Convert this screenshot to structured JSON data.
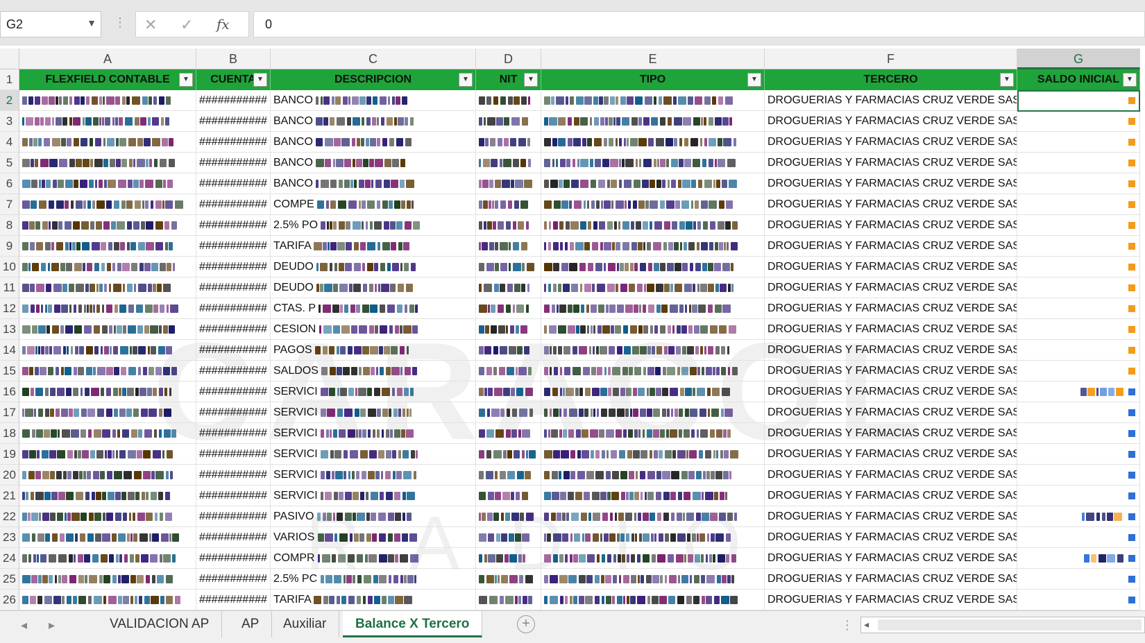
{
  "formula_bar": {
    "name_box": "G2",
    "cancel_glyph": "✕",
    "enter_glyph": "✓",
    "fx_glyph": "fx",
    "formula": "0"
  },
  "columns": [
    {
      "letter": "A",
      "header": "FLEXFIELD CONTABLE"
    },
    {
      "letter": "B",
      "header": "CUENTA"
    },
    {
      "letter": "C",
      "header": "DESCRIPCION"
    },
    {
      "letter": "D",
      "header": "NIT"
    },
    {
      "letter": "E",
      "header": "TIPO"
    },
    {
      "letter": "F",
      "header": "TERCERO"
    },
    {
      "letter": "G",
      "header": "SALDO INICIAL"
    }
  ],
  "header_row_number": "1",
  "rows": [
    {
      "n": "2",
      "b": "###########",
      "c": "BANCO",
      "f": "DROGUERIAS Y FARMACIAS CRUZ VERDE SAS"
    },
    {
      "n": "3",
      "b": "###########",
      "c": "BANCO",
      "f": "DROGUERIAS Y FARMACIAS CRUZ VERDE SAS"
    },
    {
      "n": "4",
      "b": "###########",
      "c": "BANCO",
      "f": "DROGUERIAS Y FARMACIAS CRUZ VERDE SAS"
    },
    {
      "n": "5",
      "b": "###########",
      "c": "BANCO",
      "f": "DROGUERIAS Y FARMACIAS CRUZ VERDE SAS"
    },
    {
      "n": "6",
      "b": "###########",
      "c": "BANCO",
      "f": "DROGUERIAS Y FARMACIAS CRUZ VERDE SAS"
    },
    {
      "n": "7",
      "b": "###########",
      "c": "COMPE",
      "f": "DROGUERIAS Y FARMACIAS CRUZ VERDE SAS"
    },
    {
      "n": "8",
      "b": "###########",
      "c": "2.5% PO",
      "f": "DROGUERIAS Y FARMACIAS CRUZ VERDE SAS"
    },
    {
      "n": "9",
      "b": "###########",
      "c": "TARIFA",
      "f": "DROGUERIAS Y FARMACIAS CRUZ VERDE SAS"
    },
    {
      "n": "10",
      "b": "###########",
      "c": "DEUDO",
      "f": "DROGUERIAS Y FARMACIAS CRUZ VERDE SAS"
    },
    {
      "n": "11",
      "b": "###########",
      "c": "DEUDO",
      "f": "DROGUERIAS Y FARMACIAS CRUZ VERDE SAS"
    },
    {
      "n": "12",
      "b": "###########",
      "c": "CTAS. P",
      "f": "DROGUERIAS Y FARMACIAS CRUZ VERDE SAS"
    },
    {
      "n": "13",
      "b": "###########",
      "c": "CESION",
      "f": "DROGUERIAS Y FARMACIAS CRUZ VERDE SAS"
    },
    {
      "n": "14",
      "b": "###########",
      "c": "PAGOS",
      "f": "DROGUERIAS Y FARMACIAS CRUZ VERDE SAS"
    },
    {
      "n": "15",
      "b": "###########",
      "c": "SALDOS",
      "f": "DROGUERIAS Y FARMACIAS CRUZ VERDE SAS"
    },
    {
      "n": "16",
      "b": "###########",
      "c": "SERVICI",
      "f": "DROGUERIAS Y FARMACIAS CRUZ VERDE SAS"
    },
    {
      "n": "17",
      "b": "###########",
      "c": "SERVICI",
      "f": "DROGUERIAS Y FARMACIAS CRUZ VERDE SAS"
    },
    {
      "n": "18",
      "b": "###########",
      "c": "SERVICI",
      "f": "DROGUERIAS Y FARMACIAS CRUZ VERDE SAS"
    },
    {
      "n": "19",
      "b": "###########",
      "c": "SERVICI",
      "f": "DROGUERIAS Y FARMACIAS CRUZ VERDE SAS"
    },
    {
      "n": "20",
      "b": "###########",
      "c": "SERVICI",
      "f": "DROGUERIAS Y FARMACIAS CRUZ VERDE SAS"
    },
    {
      "n": "21",
      "b": "###########",
      "c": "SERVICI",
      "f": "DROGUERIAS Y FARMACIAS CRUZ VERDE SAS"
    },
    {
      "n": "22",
      "b": "###########",
      "c": "PASIVO",
      "f": "DROGUERIAS Y FARMACIAS CRUZ VERDE SAS"
    },
    {
      "n": "23",
      "b": "###########",
      "c": "VARIOS",
      "f": "DROGUERIAS Y FARMACIAS CRUZ VERDE SAS"
    },
    {
      "n": "24",
      "b": "###########",
      "c": "COMPR",
      "f": "DROGUERIAS Y FARMACIAS CRUZ VERDE SAS"
    },
    {
      "n": "25",
      "b": "###########",
      "c": "2.5% PC",
      "f": "DROGUERIAS Y FARMACIAS CRUZ VERDE SAS"
    },
    {
      "n": "26",
      "b": "###########",
      "c": "TARIFA",
      "f": "DROGUERIAS Y FARMACIAS CRUZ VERDE SAS"
    }
  ],
  "watermark": {
    "main": "CARACOL",
    "sub": "RADIO"
  },
  "sheet_tabs": [
    "VALIDACION AP",
    "AP",
    "Auxiliar",
    "Balance X Tercero"
  ],
  "active_sheet": "Balance X Tercero",
  "colors": {
    "header_green": "#1ea43a",
    "excel_green": "#217346"
  }
}
